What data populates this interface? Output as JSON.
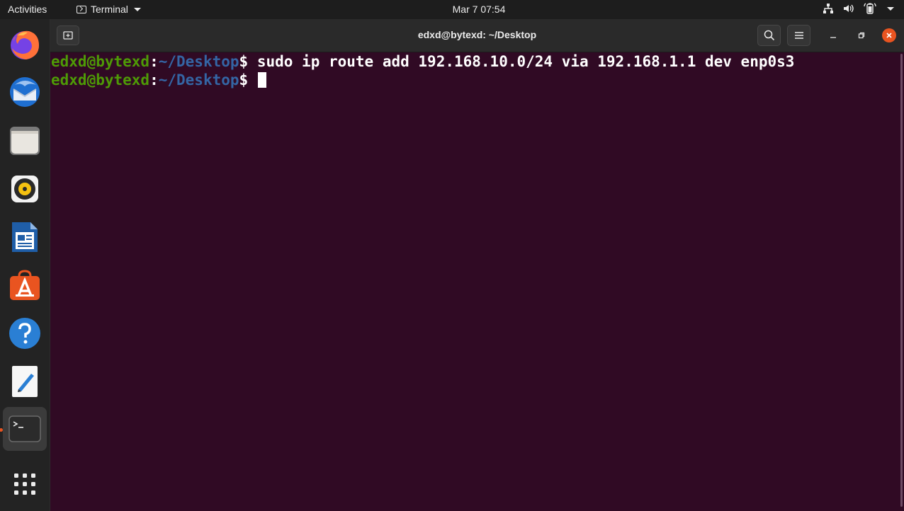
{
  "topbar": {
    "activities": "Activities",
    "app_name": "Terminal",
    "clock": "Mar 7  07:54",
    "status_icons": [
      "network-icon",
      "volume-icon",
      "battery-icon",
      "system-menu-chevron-icon"
    ]
  },
  "dock": {
    "items": [
      "firefox-icon",
      "thunderbird-icon",
      "files-icon",
      "rhythmbox-icon",
      "libreoffice-writer-icon",
      "ubuntu-software-icon",
      "help-icon",
      "text-editor-icon",
      "terminal-icon"
    ],
    "show_apps": "show-applications-icon"
  },
  "window": {
    "title": "edxd@bytexd: ~/Desktop"
  },
  "terminal": {
    "lines": [
      {
        "user_host": "edxd@bytexd",
        "colon": ":",
        "path": "~/Desktop",
        "dollar": "$",
        "command": " sudo ip route add 192.168.10.0/24 via 192.168.1.1 dev enp0s3"
      },
      {
        "user_host": "edxd@bytexd",
        "colon": ":",
        "path": "~/Desktop",
        "dollar": "$",
        "command": " "
      }
    ]
  },
  "colors": {
    "terminal_bg": "#300a24",
    "prompt_user": "#4e9a06",
    "prompt_path": "#3465a4",
    "accent": "#e95420"
  }
}
